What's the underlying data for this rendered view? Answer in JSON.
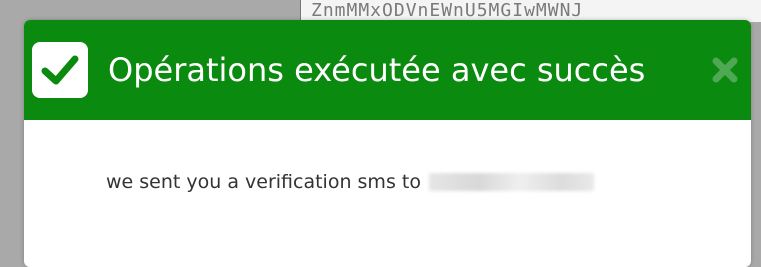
{
  "background": {
    "strip_text": "ZnmMMxODVnEWnU5MGIwMWNJ"
  },
  "modal": {
    "header_color": "#0b8a10",
    "title": "Opérations exécutée avec succès",
    "icon": "check-icon",
    "close_icon": "close-icon",
    "message": "we sent you a verification sms to"
  }
}
